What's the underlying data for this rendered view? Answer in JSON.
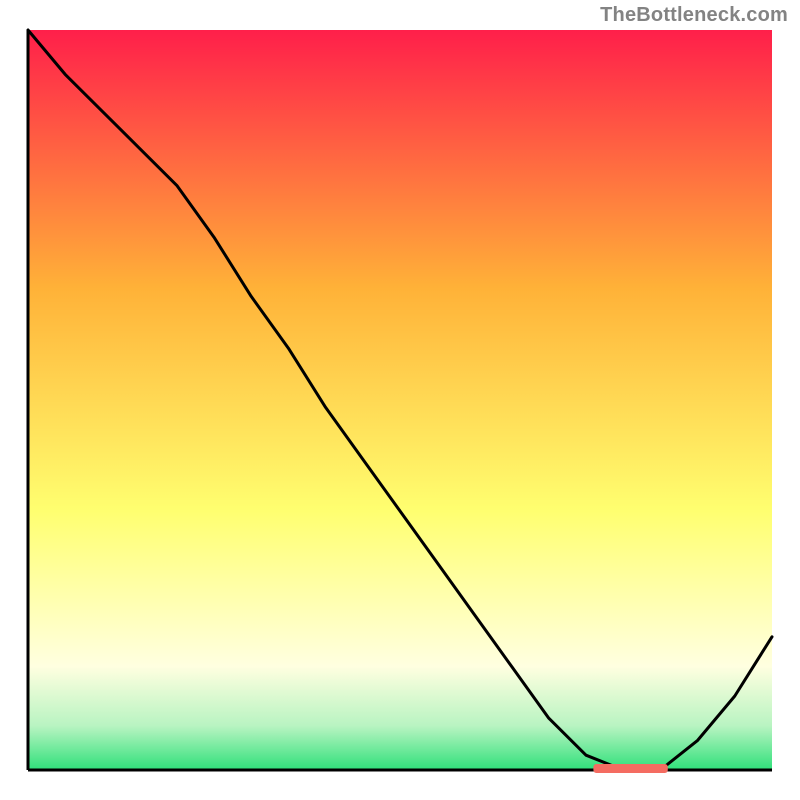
{
  "attribution": "TheBottleneck.com",
  "colors": {
    "curve_stroke": "#000000",
    "marker_fill": "#f46c61",
    "gradient_top": "#ff1f4a",
    "gradient_mid_upper": "#ffb238",
    "gradient_mid_lower": "#ffff70",
    "gradient_pale_yellow": "#ffffe0",
    "gradient_green_pale": "#b9f4c2",
    "gradient_green": "#2fe07a",
    "axis": "#000000"
  },
  "chart_data": {
    "type": "line",
    "title": "",
    "xlabel": "",
    "ylabel": "",
    "ylim": [
      0,
      100
    ],
    "xlim": [
      0,
      100
    ],
    "x": [
      0,
      5,
      10,
      15,
      20,
      25,
      30,
      35,
      40,
      45,
      50,
      55,
      60,
      65,
      70,
      75,
      80,
      85,
      90,
      95,
      100
    ],
    "values": [
      100,
      94,
      89,
      84,
      79,
      72,
      64,
      57,
      49,
      42,
      35,
      28,
      21,
      14,
      7,
      2,
      0,
      0,
      4,
      10,
      18
    ],
    "marker_band_x": [
      76,
      86
    ],
    "marker_band_y": 0
  }
}
